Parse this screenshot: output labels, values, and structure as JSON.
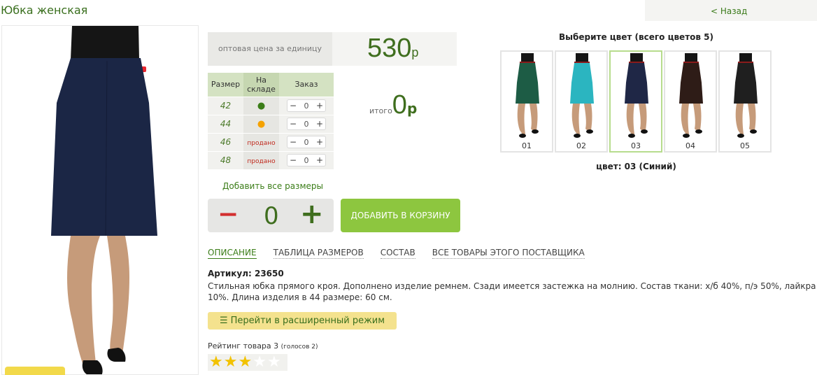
{
  "page": {
    "title": "Юбка женская",
    "back_label": "< Назад"
  },
  "price": {
    "label": "оптовая цена за единицу",
    "value": "530",
    "currency": "р"
  },
  "size_table": {
    "headers": [
      "Размер",
      "На складе",
      "Заказ"
    ],
    "rows": [
      {
        "size": "42",
        "stock": "●",
        "stock_type": "in-stock-green",
        "qty": "0"
      },
      {
        "size": "44",
        "stock": "●",
        "stock_type": "in-stock-orange",
        "qty": "0"
      },
      {
        "size": "46",
        "stock": "продано",
        "stock_type": "sold",
        "qty": "0"
      },
      {
        "size": "48",
        "stock": "продано",
        "stock_type": "sold",
        "qty": "0"
      }
    ],
    "minus": "−",
    "plus": "+"
  },
  "total": {
    "label": "итого",
    "value": "0",
    "currency": "р"
  },
  "add_all_sizes": "Добавить все размеры",
  "quantity": {
    "minus": "−",
    "value": "0",
    "plus": "+"
  },
  "cart_button": "ДОБАВИТЬ В КОРЗИНУ",
  "colors": {
    "heading": "Выберите цвет (всего цветов 5)",
    "options": [
      {
        "number": "01",
        "hex": "#1d5c45",
        "selected": false
      },
      {
        "number": "02",
        "hex": "#2bb5c0",
        "selected": false
      },
      {
        "number": "03",
        "hex": "#1f2746",
        "selected": true
      },
      {
        "number": "04",
        "hex": "#2e1c17",
        "selected": false
      },
      {
        "number": "05",
        "hex": "#1f1f1f",
        "selected": false
      }
    ],
    "current": "цвет: 03 (Синий)"
  },
  "tabs": [
    {
      "label": "ОПИСАНИЕ",
      "active": true
    },
    {
      "label": "ТАБЛИЦА РАЗМЕРОВ",
      "active": false
    },
    {
      "label": "СОСТАВ",
      "active": false
    },
    {
      "label": "ВСЕ ТОВАРЫ ЭТОГО ПОСТАВЩИКА",
      "active": false
    }
  ],
  "article": "Артикул: 23650",
  "description": "Стильная юбка прямого кроя. Дополнено изделие ремнем. Сзади имеется застежка на молнию. Состав ткани: х/б 40%, п/э 50%, лайкра 10%. Длина изделия в 44 размере: 60 см.",
  "advanced_mode": {
    "icon": "list-icon",
    "label": "Перейти в расширенный режим"
  },
  "rating": {
    "label": "Рейтинг товара 3",
    "votes": "(голосов 2)",
    "value": 3,
    "max": 5
  },
  "accent_colors": {
    "brand_green": "#3f6e1e",
    "cart_green": "#8dc63f",
    "sold_red": "#c0291d"
  }
}
